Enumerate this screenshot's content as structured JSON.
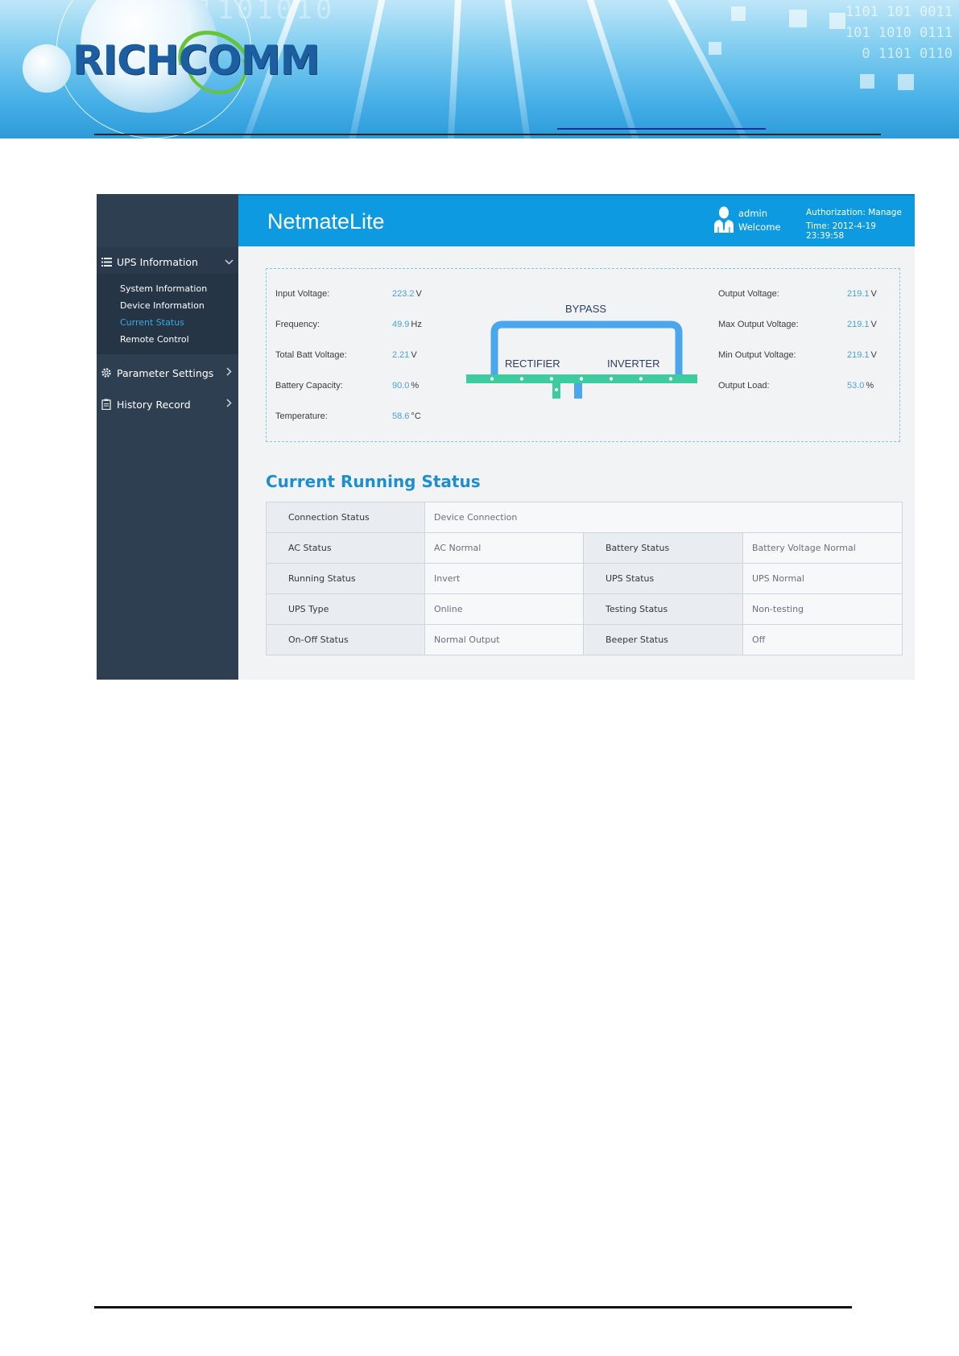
{
  "banner": {
    "brand": "RICHCOMM",
    "digits_right": "1101 101 0011101 1010 01110 1101 0110",
    "digits_top": "1101010"
  },
  "colors": {
    "topbar": "#0d9ae0",
    "sidebar": "#2e3f52",
    "accent": "#36a9e6",
    "flow_green": "#3ecba0",
    "flow_blue": "#4aa7ee"
  },
  "sidebar": {
    "groups": [
      {
        "icon": "list-icon",
        "label": "UPS Information",
        "open": true,
        "items": [
          "System Information",
          "Device Information",
          "Current Status",
          "Remote Control"
        ],
        "active": "Current Status"
      },
      {
        "icon": "gear-icon",
        "label": "Parameter Settings",
        "open": false
      },
      {
        "icon": "clipboard-icon",
        "label": "History Record",
        "open": false
      }
    ]
  },
  "header": {
    "product": "NetmateLite",
    "user": "admin",
    "welcome": "Welcome",
    "authorization": "Authorization: Manage",
    "time": "Time: 2012-4-19 23:39:58"
  },
  "monitor": {
    "left": [
      {
        "label": "Input Voltage:",
        "value": "223.2",
        "unit": "V"
      },
      {
        "label": "Frequency:",
        "value": "49.9",
        "unit": "Hz"
      },
      {
        "label": "Total Batt Voltage:",
        "value": "2.21",
        "unit": "V"
      },
      {
        "label": "Battery Capacity:",
        "value": "90.0",
        "unit": "%"
      },
      {
        "label": "Temperature:",
        "value": "58.6",
        "unit": "°C"
      }
    ],
    "right": [
      {
        "label": "Output Voltage:",
        "value": "219.1",
        "unit": "V"
      },
      {
        "label": "Max Output Voltage:",
        "value": "219.1",
        "unit": "V"
      },
      {
        "label": "Min Output Voltage:",
        "value": "219.1",
        "unit": "V"
      },
      {
        "label": "Output Load:",
        "value": "53.0",
        "unit": "%"
      }
    ],
    "diagram": {
      "bypass": "BYPASS",
      "rectifier": "RECTIFIER",
      "inverter": "INVERTER"
    }
  },
  "status": {
    "title": "Current Running Status",
    "connection": {
      "label": "Connection Status",
      "value": "Device Connection"
    },
    "rows": [
      {
        "k1": "AC Status",
        "v1": "AC Normal",
        "k2": "Battery Status",
        "v2": "Battery Voltage Normal"
      },
      {
        "k1": "Running Status",
        "v1": "Invert",
        "k2": "UPS Status",
        "v2": "UPS Normal"
      },
      {
        "k1": "UPS Type",
        "v1": "Online",
        "k2": "Testing Status",
        "v2": "Non-testing"
      },
      {
        "k1": "On-Off Status",
        "v1": "Normal Output",
        "k2": "Beeper Status",
        "v2": "Off"
      }
    ]
  }
}
